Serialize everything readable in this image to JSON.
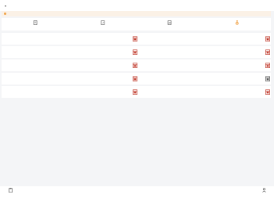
{
  "header": {
    "title": ""
  },
  "notice": {
    "text": "",
    "link": ""
  },
  "toolbar": {
    "items": [
      {
        "label": "",
        "icon": "document-icon"
      },
      {
        "label": "",
        "icon": "edit-document-icon"
      },
      {
        "label": "",
        "icon": "report-document-icon"
      },
      {
        "label": "",
        "icon": "medal-icon"
      }
    ]
  },
  "grid": {
    "rows": [
      {
        "left": {
          "title": "",
          "sub": ""
        },
        "right": {
          "title": "",
          "sub": ""
        }
      },
      {
        "left": {
          "title": "",
          "sub": ""
        },
        "right": {
          "title": "",
          "sub": ""
        }
      },
      {
        "left": {
          "title": "",
          "sub": ""
        },
        "right": {
          "title": "",
          "sub": ""
        }
      },
      {
        "left": {
          "title": "",
          "sub": ""
        },
        "right": {
          "title": "",
          "sub": ""
        }
      },
      {
        "left": {
          "title": "",
          "sub": ""
        },
        "right": {
          "title": "",
          "sub": ""
        }
      }
    ]
  },
  "bottom_nav": {
    "left": {
      "label": "",
      "icon": "clipboard-icon"
    },
    "right": {
      "label": "",
      "icon": "user-icon"
    }
  },
  "colors": {
    "accent": "#e8923a",
    "notice_bg": "#fbf1e6",
    "item_icon": "#c0392b",
    "page_bg": "#f4f5f7"
  }
}
